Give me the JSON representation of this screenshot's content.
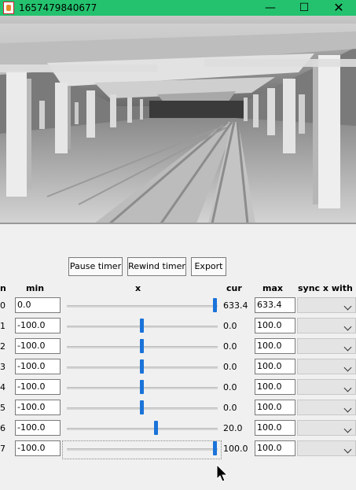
{
  "window": {
    "title": "1657479840677",
    "icon": "java-app-icon",
    "controls": {
      "minimize": "—",
      "maximize": "☐",
      "close": "✕"
    }
  },
  "toolbar": {
    "pause_label": "Pause timer",
    "rewind_label": "Rewind timer",
    "export_label": "Export"
  },
  "table": {
    "headers": {
      "index": "n",
      "min": "min",
      "slider": "x",
      "cur": "cur",
      "max": "max",
      "sync": "sync x with"
    },
    "rows": [
      {
        "index": "0",
        "min": "0.0",
        "cur": "633.4",
        "max": "633.4",
        "slider_fraction": 1.0,
        "sync": ""
      },
      {
        "index": "1",
        "min": "-100.0",
        "cur": "0.0",
        "max": "100.0",
        "slider_fraction": 0.5,
        "sync": ""
      },
      {
        "index": "2",
        "min": "-100.0",
        "cur": "0.0",
        "max": "100.0",
        "slider_fraction": 0.5,
        "sync": ""
      },
      {
        "index": "3",
        "min": "-100.0",
        "cur": "0.0",
        "max": "100.0",
        "slider_fraction": 0.5,
        "sync": ""
      },
      {
        "index": "4",
        "min": "-100.0",
        "cur": "0.0",
        "max": "100.0",
        "slider_fraction": 0.5,
        "sync": ""
      },
      {
        "index": "5",
        "min": "-100.0",
        "cur": "0.0",
        "max": "100.0",
        "slider_fraction": 0.5,
        "sync": ""
      },
      {
        "index": "6",
        "min": "-100.0",
        "cur": "20.0",
        "max": "100.0",
        "slider_fraction": 0.6,
        "sync": ""
      },
      {
        "index": "7",
        "min": "-100.0",
        "cur": "100.0",
        "max": "100.0",
        "slider_fraction": 1.0,
        "sync": ""
      }
    ]
  },
  "colors": {
    "titlebar": "#24c26e",
    "slider_thumb": "#1a73d9",
    "panel_bg": "#f0f0f0"
  }
}
